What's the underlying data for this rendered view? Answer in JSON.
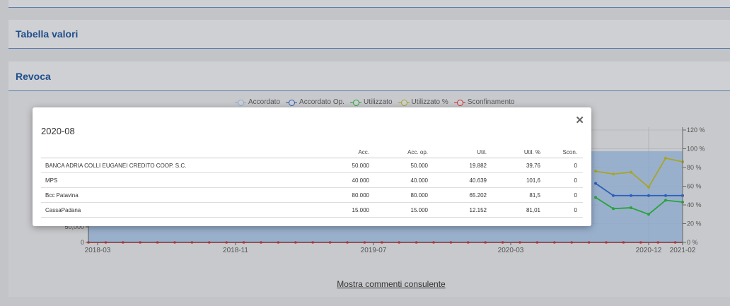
{
  "panels": {
    "tabella_title": "Tabella valori",
    "revoca_title": "Revoca",
    "comments_link": "Mostra commenti consulente"
  },
  "legend": [
    {
      "label": "Accordato",
      "color": "#8fa9d2"
    },
    {
      "label": "Accordato Op.",
      "color": "#2e5fb8"
    },
    {
      "label": "Utilizzato",
      "color": "#29a33a"
    },
    {
      "label": "Utilizzato %",
      "color": "#a6a52a"
    },
    {
      "label": "Sconfinamento",
      "color": "#d23030"
    }
  ],
  "chart_data": {
    "type": "line",
    "x_ticks": [
      "2018-03",
      "2018-11",
      "2019-07",
      "2020-03",
      "2020-12",
      "2021-02"
    ],
    "y_left_ticks": [
      "0",
      "50,000"
    ],
    "y_right_ticks": [
      "0 %",
      "20 %",
      "40 %",
      "60 %",
      "80 %",
      "100 %",
      "120 %"
    ],
    "y_right_range": [
      0,
      120
    ],
    "series": [
      {
        "name": "Utilizzato %",
        "values_right": [
          76,
          73,
          75,
          59,
          90,
          86
        ]
      },
      {
        "name": "Utilizzato",
        "values_right": [
          48,
          36,
          37,
          30,
          45,
          43
        ]
      },
      {
        "name": "Accordato Op.",
        "values_right": [
          63,
          50,
          50,
          50,
          50,
          50
        ]
      },
      {
        "name": "Sconfinamento",
        "values_right": [
          0
        ]
      }
    ]
  },
  "modal": {
    "title": "2020-08",
    "close_symbol": "✕",
    "headers": [
      "Acc.",
      "Acc. op.",
      "Util.",
      "Util. %",
      "Scon."
    ],
    "rows": [
      {
        "name": "BANCA ADRIA COLLI EUGANEI CREDITO COOP. S.C.",
        "acc": "50.000",
        "acc_op": "50.000",
        "util": "19.882",
        "util_pct": "39,76",
        "scon": "0"
      },
      {
        "name": "MPS",
        "acc": "40.000",
        "acc_op": "40.000",
        "util": "40.639",
        "util_pct": "101,6",
        "scon": "0"
      },
      {
        "name": "Bcc Patavina",
        "acc": "80.000",
        "acc_op": "80.000",
        "util": "65.202",
        "util_pct": "81,5",
        "scon": "0"
      },
      {
        "name": "CassaPadana",
        "acc": "15.000",
        "acc_op": "15.000",
        "util": "12.152",
        "util_pct": "81,01",
        "scon": "0"
      }
    ]
  }
}
